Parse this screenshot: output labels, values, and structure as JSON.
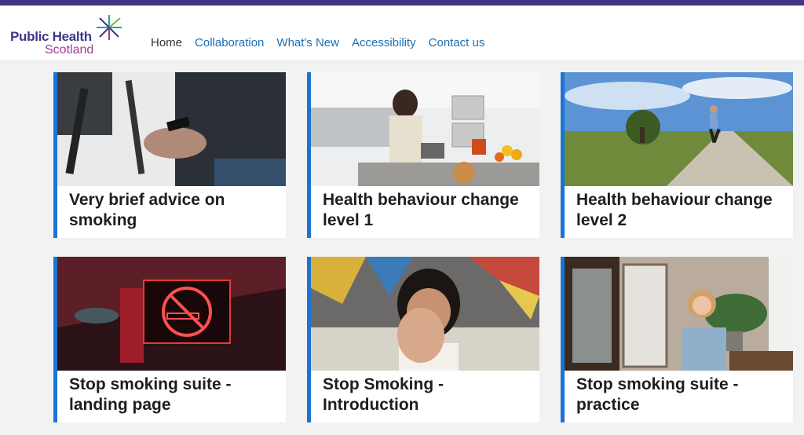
{
  "header": {
    "logo": {
      "line1": "Public Health",
      "line2": "Scotland"
    },
    "nav": [
      {
        "label": "Home"
      },
      {
        "label": "Collaboration"
      },
      {
        "label": "What's New"
      },
      {
        "label": "Accessibility"
      },
      {
        "label": "Contact us"
      }
    ]
  },
  "cards": [
    {
      "title": "Very brief advice on smoking",
      "image_icon": "photo-hands-phone-icon"
    },
    {
      "title": "Health behaviour change level 1",
      "image_icon": "photo-kitchen-cooking-icon"
    },
    {
      "title": "Health behaviour change level 2",
      "image_icon": "photo-runner-countryside-icon"
    },
    {
      "title": "Stop smoking suite - landing page",
      "image_icon": "photo-no-smoking-sign-icon"
    },
    {
      "title": "Stop Smoking - Introduction",
      "image_icon": "photo-child-hand-stop-icon"
    },
    {
      "title": "Stop smoking suite - practice",
      "image_icon": "photo-smiling-woman-icon"
    }
  ],
  "colors": {
    "top_bar": "#3f3685",
    "card_accent": "#1a74d6",
    "nav_link": "#1a6fb4"
  }
}
